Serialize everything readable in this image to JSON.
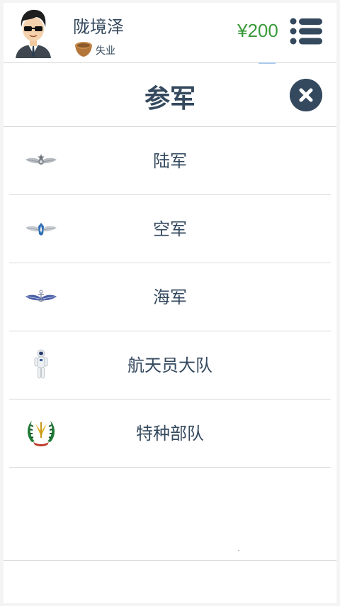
{
  "player": {
    "name": "陇境泽",
    "job_icon": "wooden-bowl-icon",
    "job": "失业"
  },
  "wallet": {
    "money": "¥200"
  },
  "header": {
    "menu_icon": "list-menu-icon"
  },
  "modal": {
    "title": "参军",
    "close_icon": "close-icon",
    "options": [
      {
        "label": "陆军",
        "icon": "army-wings-badge-icon"
      },
      {
        "label": "空军",
        "icon": "air-force-wings-badge-icon"
      },
      {
        "label": "海军",
        "icon": "navy-anchor-badge-icon"
      },
      {
        "label": "航天员大队",
        "icon": "astronaut-icon"
      },
      {
        "label": "特种部队",
        "icon": "special-forces-emblem-icon"
      }
    ]
  },
  "colors": {
    "text": "#34495e",
    "money": "#3a9a3a",
    "close_bg": "#34495e"
  }
}
